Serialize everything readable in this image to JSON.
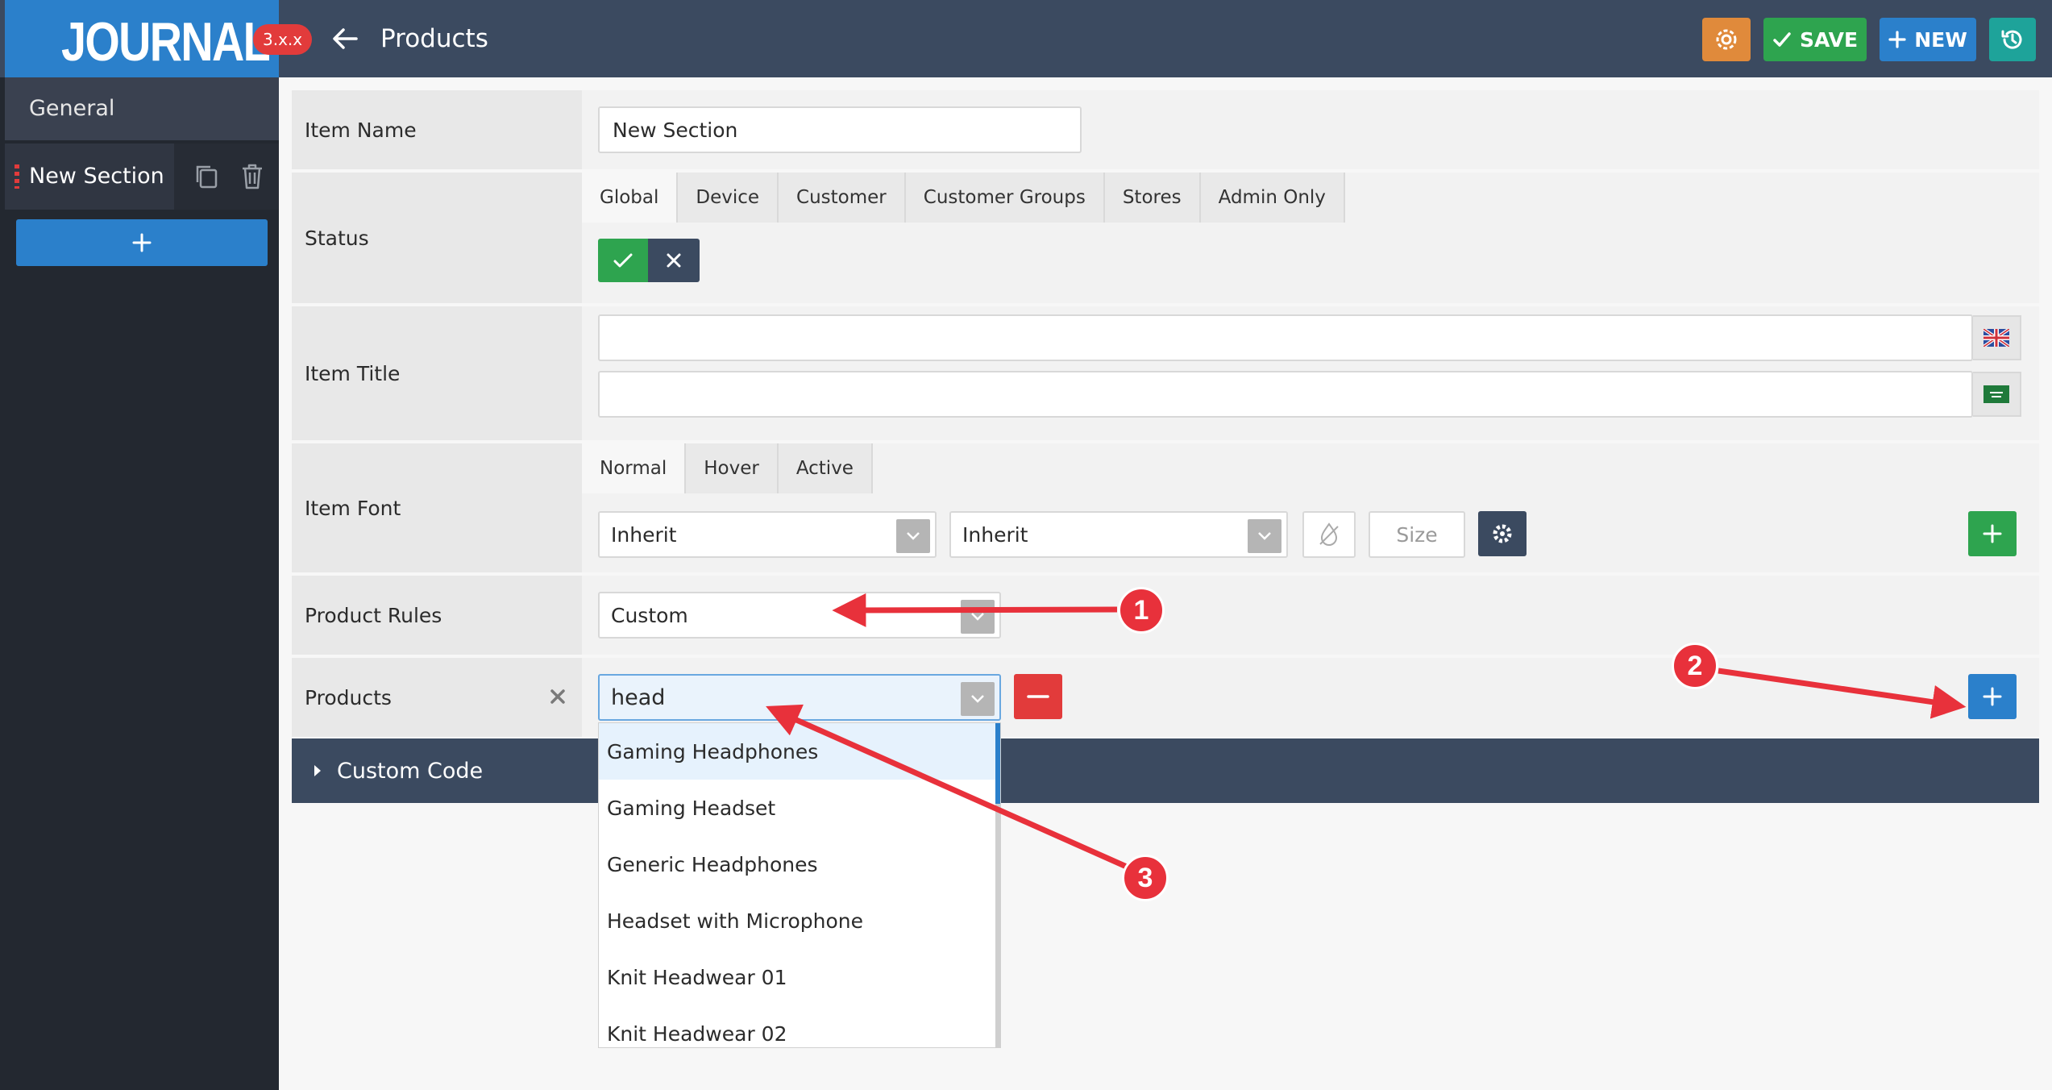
{
  "header": {
    "logo": "JOURNAL",
    "version": "3.x.x",
    "title": "Products",
    "save_label": "SAVE",
    "new_label": "NEW"
  },
  "sidebar": {
    "general_label": "General",
    "items": [
      {
        "label": "New Section"
      }
    ]
  },
  "form": {
    "item_name": {
      "label": "Item Name",
      "value": "New Section"
    },
    "status": {
      "label": "Status",
      "tabs": [
        "Global",
        "Device",
        "Customer",
        "Customer Groups",
        "Stores",
        "Admin Only"
      ]
    },
    "item_title": {
      "label": "Item Title",
      "value_1": "",
      "value_2": ""
    },
    "item_font": {
      "label": "Item Font",
      "tabs": [
        "Normal",
        "Hover",
        "Active"
      ],
      "family": "Inherit",
      "weight": "Inherit",
      "size_placeholder": "Size"
    },
    "product_rules": {
      "label": "Product Rules",
      "value": "Custom"
    },
    "products": {
      "label": "Products",
      "search_value": "head"
    }
  },
  "custom_code": {
    "label": "Custom Code"
  },
  "dropdown": {
    "options": [
      "Gaming Headphones",
      "Gaming Headset",
      "Generic Headphones",
      "Headset with Microphone",
      "Knit Headwear 01",
      "Knit Headwear 02"
    ]
  },
  "annotations": {
    "badges": [
      "1",
      "2",
      "3"
    ]
  },
  "colors": {
    "header_bg": "#3b4a60",
    "logo_bg": "#2b80cb",
    "save": "#2ea44f",
    "new": "#2b80cb",
    "settings": "#e08a3b",
    "history": "#1ea39a",
    "remove": "#e23b3b",
    "annotation": "#e8313b"
  }
}
